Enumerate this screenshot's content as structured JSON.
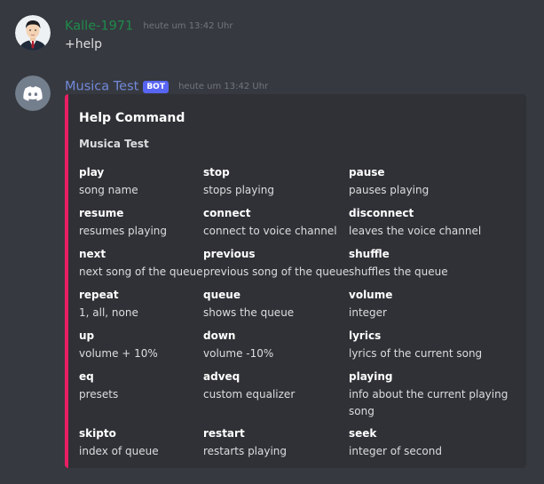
{
  "messages": [
    {
      "username": "Kalle-1971",
      "timestamp": "heute um 13:42 Uhr",
      "content": "+help",
      "name_color": "#1f8b4c"
    },
    {
      "username": "Musica Test",
      "badge": "BOT",
      "timestamp": "heute um 13:42 Uhr",
      "name_color": "#7289da",
      "embed": {
        "accent_color": "#e91e63",
        "title": "Help Command",
        "description": "Musica Test",
        "fields": [
          {
            "name": "play",
            "value": "song name"
          },
          {
            "name": "stop",
            "value": "stops playing"
          },
          {
            "name": "pause",
            "value": "pauses playing"
          },
          {
            "name": "resume",
            "value": "resumes playing"
          },
          {
            "name": "connect",
            "value": "connect to voice channel"
          },
          {
            "name": "disconnect",
            "value": "leaves the voice channel"
          },
          {
            "name": "next",
            "value": "next song of the queue"
          },
          {
            "name": "previous",
            "value": "previous song of the queue"
          },
          {
            "name": "shuffle",
            "value": "shuffles the queue"
          },
          {
            "name": "repeat",
            "value": "1, all, none"
          },
          {
            "name": "queue",
            "value": "shows the queue"
          },
          {
            "name": "volume",
            "value": "integer"
          },
          {
            "name": "up",
            "value": "volume + 10%"
          },
          {
            "name": "down",
            "value": "volume -10%"
          },
          {
            "name": "lyrics",
            "value": "lyrics of the current song"
          },
          {
            "name": "eq",
            "value": "presets"
          },
          {
            "name": "adveq",
            "value": "custom equalizer"
          },
          {
            "name": "playing",
            "value": "info about the current playing song"
          },
          {
            "name": "skipto",
            "value": "index of queue"
          },
          {
            "name": "restart",
            "value": "restarts playing"
          },
          {
            "name": "seek",
            "value": "integer of second"
          }
        ]
      }
    }
  ],
  "icons": {
    "user_avatar": "user-portrait-avatar",
    "bot_avatar": "discord-logo-icon"
  }
}
